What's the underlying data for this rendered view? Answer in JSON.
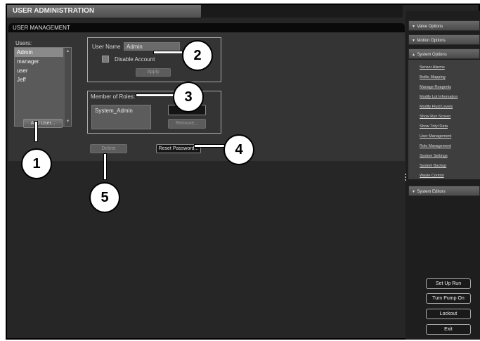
{
  "window": {
    "title": "USER ADMINISTRATION"
  },
  "panel": {
    "title": "USER MANAGEMENT"
  },
  "users": {
    "label": "Users:",
    "items": [
      "Admin",
      "manager",
      "user",
      "Jeff"
    ],
    "selected": "Admin",
    "add_button": "Add User..."
  },
  "account": {
    "user_name_label": "User Name",
    "user_name_value": "Admin",
    "disable_label": "Disable Account",
    "apply_button": "Apply"
  },
  "roles": {
    "label": "Member of Roles:",
    "items": [
      "System_Admin"
    ],
    "remove_button": "Remove..."
  },
  "actions": {
    "delete_button": "Delete",
    "reset_password_button": "Reset Password..."
  },
  "callouts": [
    "1",
    "2",
    "3",
    "4",
    "5"
  ],
  "sidebar": {
    "sections": [
      "Valve Options",
      "Motion Options",
      "System Options",
      "System Editors"
    ],
    "links": [
      "Sensor Alarms",
      "Bottle Mapping",
      "Manage Reagents",
      "Modify Lot Information",
      "Modify Fluid Levels",
      "Show Run Screen",
      "Show Trityl Data",
      "User Management",
      "Role Management",
      "System Settings",
      "System Backup",
      "Waste Control"
    ],
    "buttons": [
      "Set Up Run",
      "Turn Pump On",
      "Lockout",
      "Exit"
    ]
  }
}
